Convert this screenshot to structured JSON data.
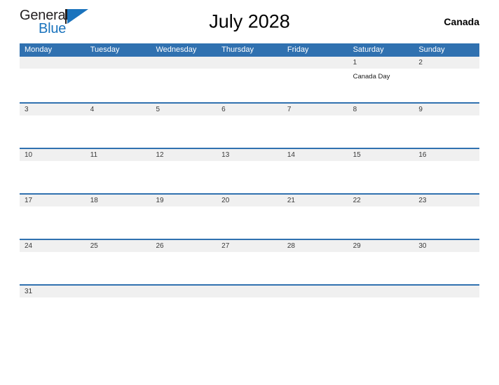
{
  "brand": {
    "word_one": "General",
    "word_two": "Blue",
    "triangle_color": "#1a73bd",
    "text_color": "#231f20"
  },
  "header": {
    "title": "July 2028",
    "country": "Canada",
    "accent_color": "#3071b0",
    "band_color": "#f0f0f0"
  },
  "calendar": {
    "weekday_headers": [
      "Monday",
      "Tuesday",
      "Wednesday",
      "Thursday",
      "Friday",
      "Saturday",
      "Sunday"
    ],
    "weeks": [
      {
        "days": [
          {
            "number": "",
            "events": []
          },
          {
            "number": "",
            "events": []
          },
          {
            "number": "",
            "events": []
          },
          {
            "number": "",
            "events": []
          },
          {
            "number": "",
            "events": []
          },
          {
            "number": "1",
            "events": [
              "Canada Day"
            ]
          },
          {
            "number": "2",
            "events": []
          }
        ]
      },
      {
        "days": [
          {
            "number": "3",
            "events": []
          },
          {
            "number": "4",
            "events": []
          },
          {
            "number": "5",
            "events": []
          },
          {
            "number": "6",
            "events": []
          },
          {
            "number": "7",
            "events": []
          },
          {
            "number": "8",
            "events": []
          },
          {
            "number": "9",
            "events": []
          }
        ]
      },
      {
        "days": [
          {
            "number": "10",
            "events": []
          },
          {
            "number": "11",
            "events": []
          },
          {
            "number": "12",
            "events": []
          },
          {
            "number": "13",
            "events": []
          },
          {
            "number": "14",
            "events": []
          },
          {
            "number": "15",
            "events": []
          },
          {
            "number": "16",
            "events": []
          }
        ]
      },
      {
        "days": [
          {
            "number": "17",
            "events": []
          },
          {
            "number": "18",
            "events": []
          },
          {
            "number": "19",
            "events": []
          },
          {
            "number": "20",
            "events": []
          },
          {
            "number": "21",
            "events": []
          },
          {
            "number": "22",
            "events": []
          },
          {
            "number": "23",
            "events": []
          }
        ]
      },
      {
        "days": [
          {
            "number": "24",
            "events": []
          },
          {
            "number": "25",
            "events": []
          },
          {
            "number": "26",
            "events": []
          },
          {
            "number": "27",
            "events": []
          },
          {
            "number": "28",
            "events": []
          },
          {
            "number": "29",
            "events": []
          },
          {
            "number": "30",
            "events": []
          }
        ]
      },
      {
        "days": [
          {
            "number": "31",
            "events": []
          },
          {
            "number": "",
            "events": []
          },
          {
            "number": "",
            "events": []
          },
          {
            "number": "",
            "events": []
          },
          {
            "number": "",
            "events": []
          },
          {
            "number": "",
            "events": []
          },
          {
            "number": "",
            "events": []
          }
        ]
      }
    ]
  }
}
